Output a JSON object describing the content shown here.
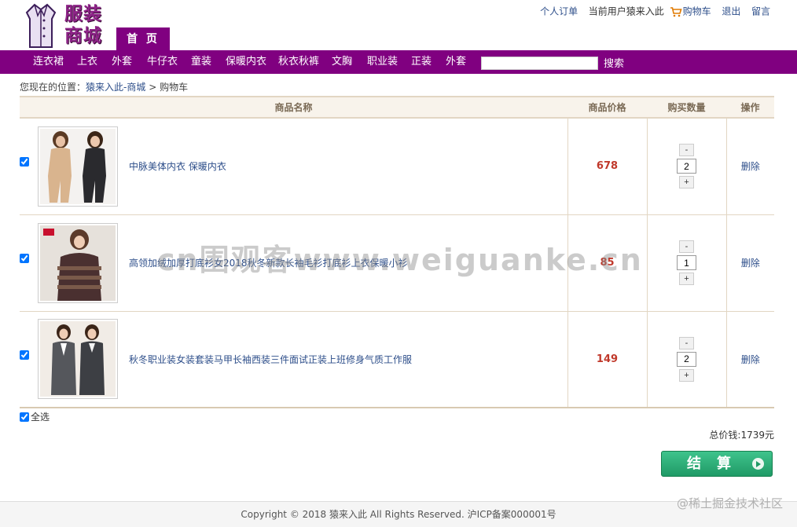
{
  "header": {
    "logo_text_line1": "服装",
    "logo_text_line2": "商城",
    "home_tab": "首 页",
    "top_links": {
      "orders": "个人订单",
      "current_user_prefix": "当前用户",
      "current_user": "猿来入此",
      "cart": "购物车",
      "logout": "退出",
      "message": "留言"
    }
  },
  "nav": {
    "items": [
      "连衣裙",
      "上衣",
      "外套",
      "牛仔衣",
      "童装",
      "保暖内衣",
      "秋衣秋裤",
      "文胸",
      "职业装",
      "正装",
      "外套"
    ],
    "search_value": "",
    "search_button": "搜索"
  },
  "breadcrumb": {
    "prefix": "您现在的位置：",
    "home": "猿来入此-商城",
    "separator": ">",
    "current": "购物车"
  },
  "table": {
    "headers": [
      "商品名称",
      "商品价格",
      "购买数量",
      "操作"
    ],
    "rows": [
      {
        "name": "中脉美体内衣 保暖内衣",
        "price": "678",
        "quantity": "2",
        "minus": "-",
        "plus": "+",
        "delete": "删除",
        "checked": true
      },
      {
        "name": "高领加绒加厚打底衫女2018秋冬新款长袖毛衫打底衫上衣保暖小衫",
        "price": "85",
        "quantity": "1",
        "minus": "-",
        "plus": "+",
        "delete": "删除",
        "checked": true
      },
      {
        "name": "秋冬职业装女装套装马甲长袖西装三件面试正装上班修身气质工作服",
        "price": "149",
        "quantity": "2",
        "minus": "-",
        "plus": "+",
        "delete": "删除",
        "checked": true
      }
    ]
  },
  "select_all_label": "全选",
  "total_text": "总价钱:1739元",
  "checkout_label": "结算",
  "footer_text": "Copyright © 2018 猿来入此 All Rights Reserved. 沪ICP备案000001号",
  "watermark_text": "cn围观客www.weiguanke.cn",
  "corner_watermark": "@稀土掘金技术社区",
  "colors": {
    "brand_purple": "#800080",
    "price_red": "#c0392b",
    "link_blue": "#2d4e8a",
    "checkout_green": "#1f9a66"
  }
}
